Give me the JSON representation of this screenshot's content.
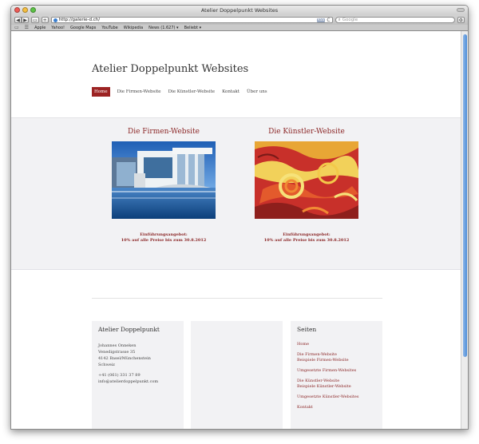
{
  "browser": {
    "window_title": "Atelier Doppelpunkt Websites",
    "url": "http://galerie-d.ch/",
    "rss_label": "RSS",
    "search_placeholder": "Google",
    "buttons": {
      "back": "◀",
      "forward": "▶",
      "tabs": "▭",
      "add": "+",
      "reload": "C",
      "gear": "⚙"
    },
    "bookmarks": [
      "Apple",
      "Yahoo!",
      "Google Maps",
      "YouTube",
      "Wikipedia",
      "News (1.627) ▾",
      "Beliebt ▾"
    ],
    "bookmark_icons": [
      "book-icon",
      "grid-icon"
    ]
  },
  "site": {
    "title": "Atelier Doppelpunkt Websites",
    "nav": [
      {
        "label": "Home",
        "active": true
      },
      {
        "label": "Die Firmen-Website",
        "active": false
      },
      {
        "label": "Die Künstler-Website",
        "active": false
      },
      {
        "label": "Kontakt",
        "active": false
      },
      {
        "label": "Über uns",
        "active": false
      }
    ]
  },
  "features": [
    {
      "title": "Die Firmen-Website",
      "image": "modern-building-photo",
      "offer_line1": "Einführungsangebot:",
      "offer_line2": "10% auf alle Preise bis zum 30.8.2012"
    },
    {
      "title": "Die Künstler-Website",
      "image": "abstract-art-photo",
      "offer_line1": "Einführungsangebot:",
      "offer_line2": "10% auf alle Preise bis zum 30.8.2012"
    }
  ],
  "footer": {
    "contact": {
      "title": "Atelier Doppelpunkt",
      "lines": [
        "Johannes Onneken",
        "Venedigstrasse 35",
        "4142 Basel/Münchenstein",
        "Schweiz"
      ],
      "phone": "+41 (061) 331 37 89",
      "email": "info@atelierdoppelpunkt.com"
    },
    "pages": {
      "title": "Seiten",
      "links": [
        "Home",
        "Die Firmen-Website",
        "Beispiele Firmen-Website",
        "Umgesetzte Firmen-Websites",
        "Die Künstler-Website",
        "Beispiele Künstler-Website",
        "Umgesetzte Künstler-Websites",
        "Kontakt"
      ]
    }
  },
  "colors": {
    "accent": "#9c2323",
    "link": "#8b2626",
    "panel": "#f2f2f4",
    "scrollbar": "#4f8ed8"
  }
}
